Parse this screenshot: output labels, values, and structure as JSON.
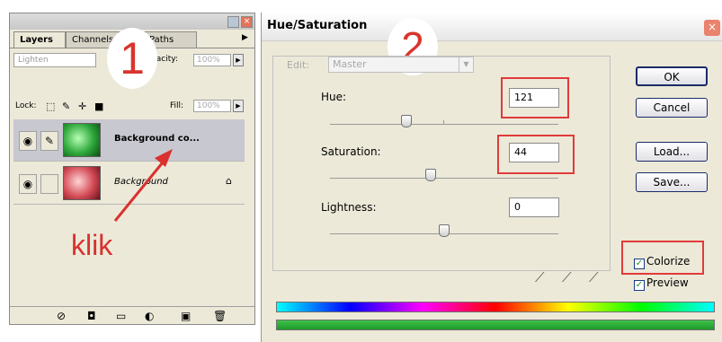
{
  "layers_panel": {
    "tabs": [
      "Layers",
      "Channels",
      "Paths"
    ],
    "blend_mode": "Lighten",
    "opacity_label": "Opacity:",
    "opacity_value": "100%",
    "lock_label": "Lock:",
    "fill_label": "Fill:",
    "fill_value": "100%",
    "layers": [
      {
        "name": "Background co...",
        "thumb_color": "#2ea63a",
        "selected": true
      },
      {
        "name": "Background",
        "thumb_color": "#d34b56",
        "selected": false
      }
    ],
    "annotation_number": "1",
    "annotation_text": "klik"
  },
  "dialog": {
    "title": "Hue/Saturation",
    "annotation_number": "2",
    "edit_label": "Edit:",
    "edit_value": "Master",
    "hue_label": "Hue:",
    "hue_value": "121",
    "saturation_label": "Saturation:",
    "saturation_value": "44",
    "lightness_label": "Lightness:",
    "lightness_value": "0",
    "buttons": {
      "ok": "OK",
      "cancel": "Cancel",
      "load": "Load...",
      "save": "Save..."
    },
    "colorize_label": "Colorize",
    "colorize_checked": true,
    "preview_label": "Preview",
    "preview_checked": true,
    "accent_color": "#e13a3a"
  }
}
